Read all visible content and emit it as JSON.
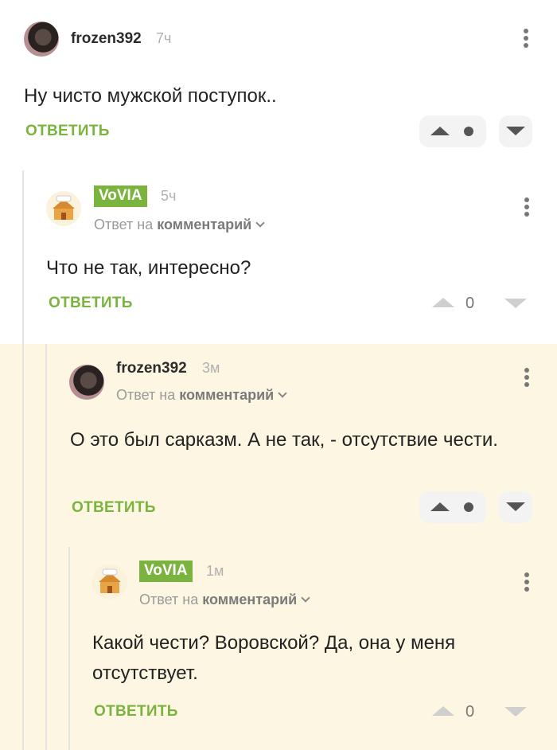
{
  "colors": {
    "accent": "#7ab43e",
    "highlight_bg": "#fcf6e3",
    "muted": "#b0b0b0"
  },
  "comments": [
    {
      "author": "frozen392",
      "time": "7ч",
      "text": "Ну чисто мужской поступок..",
      "reply_label": "ОТВЕТИТЬ",
      "avatar": "cat-avatar",
      "vote": "up-dot-down"
    },
    {
      "author": "VoVIA",
      "time": "5ч",
      "reply_to_prefix": "Ответ на",
      "reply_to_target": "комментарий",
      "text": "Что не так, интересно?",
      "reply_label": "ОТВЕТИТЬ",
      "rating": "0",
      "avatar": "house-avatar"
    },
    {
      "author": "frozen392",
      "time": "3м",
      "reply_to_prefix": "Ответ на",
      "reply_to_target": "комментарий",
      "text": "О это был сарказм. А не так, - отсутствие чести.",
      "reply_label": "ОТВЕТИТЬ",
      "avatar": "cat-avatar",
      "vote": "up-dot-down"
    },
    {
      "author": "VoVIA",
      "time": "1м",
      "reply_to_prefix": "Ответ на",
      "reply_to_target": "комментарий",
      "text": "Какой чести? Воровской? Да, она у меня отсутствует.",
      "reply_label": "ОТВЕТИТЬ",
      "rating": "0",
      "avatar": "house-avatar"
    }
  ]
}
